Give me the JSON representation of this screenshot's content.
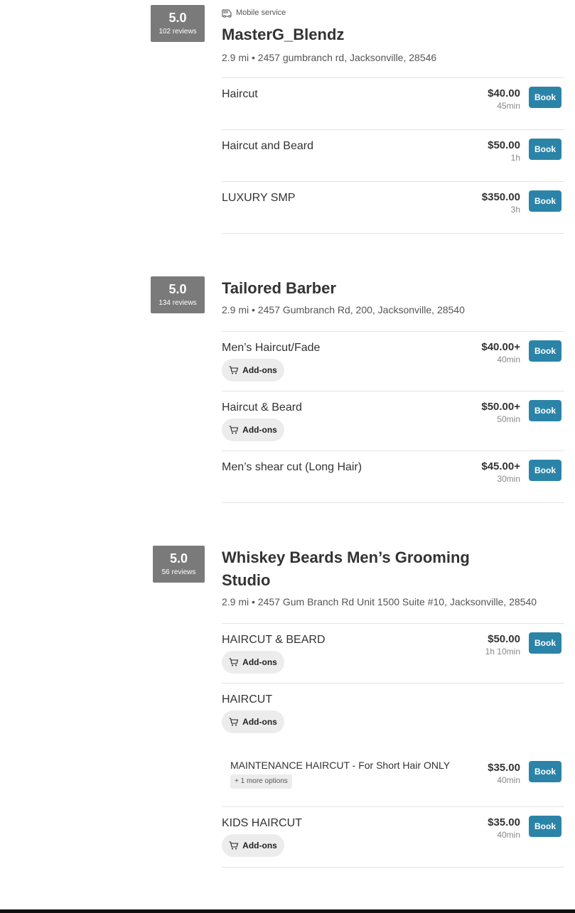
{
  "shops": [
    {
      "rating": "5.0",
      "reviews": "102 reviews",
      "tag": "Mobile service",
      "name": "MasterG_Blendz",
      "address": "2.9 mi • 2457 gumbranch rd, Jacksonville, 28546",
      "services": [
        {
          "name": "Haircut",
          "price": "$40.00",
          "duration": "45min",
          "book": "Book"
        },
        {
          "name": "Haircut and Beard",
          "price": "$50.00",
          "duration": "1h",
          "book": "Book"
        },
        {
          "name": "LUXURY SMP",
          "price": "$350.00",
          "duration": "3h",
          "book": "Book"
        }
      ]
    },
    {
      "rating": "5.0",
      "reviews": "134 reviews",
      "name": "Tailored Barber",
      "address": "2.9 mi • 2457 Gumbranch Rd, 200, Jacksonville, 28540",
      "services": [
        {
          "name": "Men’s Haircut/Fade",
          "price": "$40.00+",
          "duration": "40min",
          "book": "Book",
          "addons": "Add-ons"
        },
        {
          "name": "Haircut & Beard",
          "price": "$50.00+",
          "duration": "50min",
          "book": "Book",
          "addons": "Add-ons"
        },
        {
          "name": "Men’s shear cut (Long Hair)",
          "price": "$45.00+",
          "duration": "30min",
          "book": "Book"
        }
      ]
    },
    {
      "rating": "5.0",
      "reviews": "56 reviews",
      "name_line1": "Whiskey Beards Men’s Grooming",
      "name_line2": "Studio",
      "address": "2.9 mi • 2457 Gum Branch Rd Unit 1500 Suite #10, Jacksonville, 28540",
      "services": [
        {
          "name": "HAIRCUT & BEARD",
          "price": "$50.00",
          "duration": "1h 10min",
          "book": "Book",
          "addons": "Add-ons"
        },
        {
          "name": "HAIRCUT",
          "addons": "Add-ons",
          "sub": {
            "name": "MAINTENANCE HAIRCUT - For Short Hair ONLY",
            "more": "+ 1 more options",
            "price": "$35.00",
            "duration": "40min",
            "book": "Book"
          }
        },
        {
          "name": "KIDS HAIRCUT",
          "price": "$35.00",
          "duration": "40min",
          "book": "Book",
          "addons": "Add-ons"
        }
      ]
    }
  ],
  "icons": {
    "mobile": "van-icon",
    "cart": "cart-icon"
  },
  "colors": {
    "book_button": "#2b84a8",
    "rating_box": "#7a7a7a",
    "addons_bg": "#ececec"
  }
}
